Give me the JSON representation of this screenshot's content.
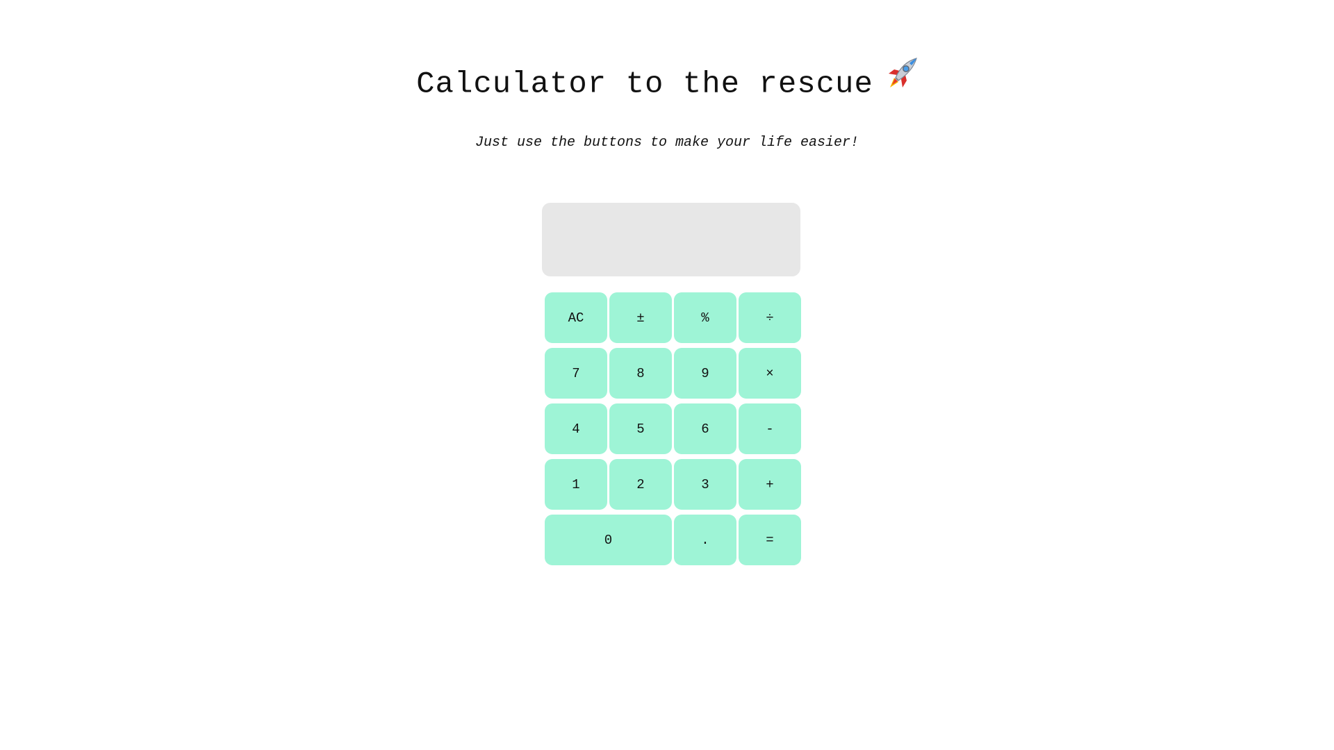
{
  "header": {
    "title": "Calculator to the rescue",
    "title_icon": "rocket-icon",
    "subtitle": "Just use the buttons to make your life easier!"
  },
  "display": {
    "value": ""
  },
  "keys": {
    "clear": "AC",
    "sign": "±",
    "percent": "%",
    "divide": "÷",
    "seven": "7",
    "eight": "8",
    "nine": "9",
    "multiply": "×",
    "four": "4",
    "five": "5",
    "six": "6",
    "subtract": "-",
    "one": "1",
    "two": "2",
    "three": "3",
    "add": "+",
    "zero": "0",
    "decimal": ".",
    "equals": "="
  },
  "colors": {
    "key_background": "#9ef4d6",
    "display_background": "#e7e7e7"
  }
}
